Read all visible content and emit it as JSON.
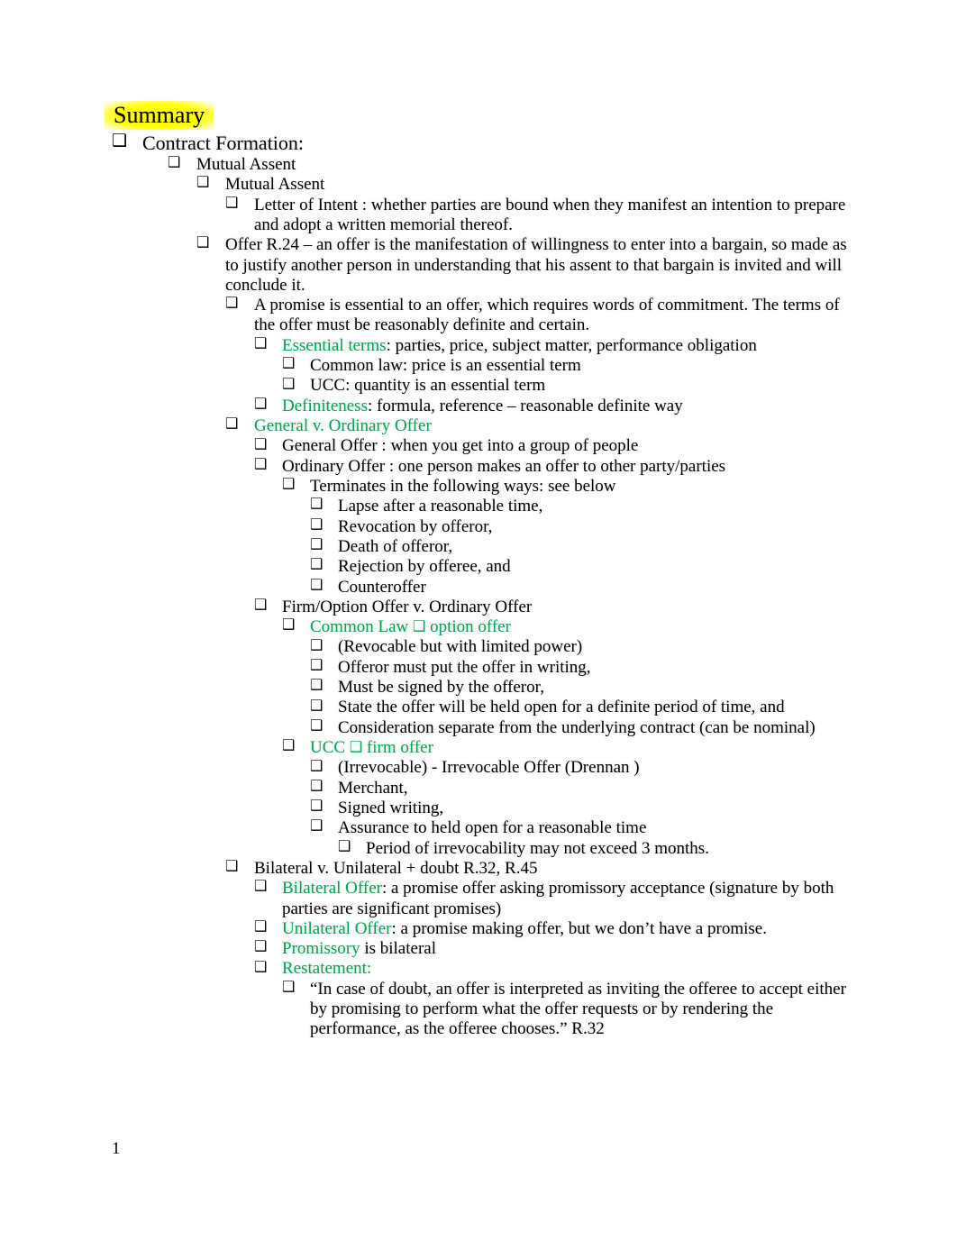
{
  "document": {
    "title": "Summary",
    "highlight_color": "#FFFF00",
    "accent_green": "#00A551",
    "page_number": "1",
    "bullet_glyph": "❑"
  },
  "outline": [
    {
      "id": "contract-formation",
      "level": 0,
      "bullet": "❑",
      "text": "Contract Formation:"
    },
    {
      "id": "mutual-assent-1",
      "level": 1,
      "bullet": "❑",
      "text": "Mutual Assent"
    },
    {
      "id": "mutual-assent-2",
      "level": 2,
      "bullet": "❑",
      "text": "Mutual Assent"
    },
    {
      "id": "letter-of-intent",
      "level": 3,
      "bullet": "❑",
      "text": "Letter of Intent  : whether parties are bound when they manifest an intention to prepare and adopt a written memorial thereof."
    },
    {
      "id": "offer-r24",
      "level": 2,
      "bullet": "❑",
      "text": "Offer  R.24 – an offer is the manifestation of willingness to enter into a bargain, so made as to justify another person in understanding that his assent to that bargain is invited and will conclude it."
    },
    {
      "id": "promise-essential",
      "level": 3,
      "bullet": "❑",
      "text": "A promise is essential to an offer, which requires words of commitment. The terms of the offer must be reasonably definite and certain."
    },
    {
      "id": "essential-terms",
      "level": 4,
      "bullet": "❑",
      "green_prefix": "Essential terms",
      "text": ": parties, price, subject matter, performance obligation"
    },
    {
      "id": "common-law-price",
      "level": 5,
      "bullet": "❑",
      "text": "Common law: price  is an essential term"
    },
    {
      "id": "ucc-quantity",
      "level": 5,
      "bullet": "❑",
      "text": "UCC: quantity   is an essential term"
    },
    {
      "id": "definiteness",
      "level": 4,
      "bullet": "❑",
      "green_prefix": "Definiteness",
      "text": ": formula, reference – reasonable definite way"
    },
    {
      "id": "general-v-ordinary-offer",
      "level": 3,
      "bullet": "❑",
      "green_all": "General v. Ordinary Offer"
    },
    {
      "id": "general-offer",
      "level": 4,
      "bullet": "❑",
      "text": "General Offer  : when you get into a group of people"
    },
    {
      "id": "ordinary-offer",
      "level": 4,
      "bullet": "❑",
      "text": "Ordinary Offer  : one person makes an offer to other party/parties"
    },
    {
      "id": "terminates-ways",
      "level": 5,
      "bullet": "❑",
      "text": "Terminates in the following ways: see below"
    },
    {
      "id": "lapse",
      "level": 6,
      "bullet": "❑",
      "text": "Lapse after a reasonable time,"
    },
    {
      "id": "revocation",
      "level": 6,
      "bullet": "❑",
      "text": "Revocation by offeror,"
    },
    {
      "id": "death-of-offeror",
      "level": 6,
      "bullet": "❑",
      "text": "Death of offeror,"
    },
    {
      "id": "rejection",
      "level": 6,
      "bullet": "❑",
      "text": "Rejection by offeree, and"
    },
    {
      "id": "counteroffer",
      "level": 6,
      "bullet": "❑",
      "text": "Counteroffer"
    },
    {
      "id": "firm-option-offer",
      "level": 4,
      "bullet": "❑",
      "text": "Firm/Option Offer v. Ordinary Offer"
    },
    {
      "id": "common-law-option-offer",
      "level": 5,
      "bullet": "❑",
      "green_all": "Common Law  ❑   option offer"
    },
    {
      "id": "revocable-limited-power",
      "level": 6,
      "bullet": "❑",
      "text": "(Revocable but with limited power)"
    },
    {
      "id": "offeror-writing",
      "level": 6,
      "bullet": "❑",
      "text": "Offeror must put the offer in writing,"
    },
    {
      "id": "signed-by-offeror",
      "level": 6,
      "bullet": "❑",
      "text": "Must be signed by the offeror,"
    },
    {
      "id": "held-open-definite",
      "level": 6,
      "bullet": "❑",
      "text": "State the offer will be held open for a definite period of time, and"
    },
    {
      "id": "consideration-separate",
      "level": 6,
      "bullet": "❑",
      "text": "Consideration separate from the underlying contract (can be nominal)"
    },
    {
      "id": "ucc-firm-offer",
      "level": 5,
      "bullet": "❑",
      "green_all": "UCC ❑   firm offer"
    },
    {
      "id": "irrevocable-drennan",
      "level": 6,
      "bullet": "❑",
      "text": "(Irrevocable) - Irrevocable Offer (Drennan )"
    },
    {
      "id": "merchant",
      "level": 6,
      "bullet": "❑",
      "text": "Merchant,"
    },
    {
      "id": "signed-writing",
      "level": 6,
      "bullet": "❑",
      "text": "Signed writing,"
    },
    {
      "id": "assurance-held-open",
      "level": 6,
      "bullet": "❑",
      "text": "Assurance to held open for a reasonable time"
    },
    {
      "id": "period-irrevocability",
      "level": 7,
      "bullet": "❑",
      "text": "Period of irrevocability may not exceed 3 months."
    },
    {
      "id": "bilateral-v-unilateral",
      "level": 3,
      "bullet": "❑",
      "text": "Bilateral v. Unilateral + doubt R.32, R.45"
    },
    {
      "id": "bilateral-offer",
      "level": 4,
      "bullet": "❑",
      "green_prefix": "Bilateral Offer",
      "text": ": a promise offer asking promissory acceptance (signature by both parties are significant promises)"
    },
    {
      "id": "unilateral-offer",
      "level": 4,
      "bullet": "❑",
      "green_prefix": "Unilateral Offer",
      "text": ": a promise making offer, but we don’t have a promise."
    },
    {
      "id": "promissory",
      "level": 4,
      "bullet": "❑",
      "green_prefix": "Promissory",
      "text": " is bilateral"
    },
    {
      "id": "restatement",
      "level": 4,
      "bullet": "❑",
      "green_all": "Restatement:"
    },
    {
      "id": "restatement-quote",
      "level": 5,
      "bullet": "❑",
      "text": "“In case of doubt, an offer is interpreted as inviting the offeree to accept either by promising to perform what the offer requests or by rendering the performance, as the offeree chooses.” R.32"
    }
  ]
}
